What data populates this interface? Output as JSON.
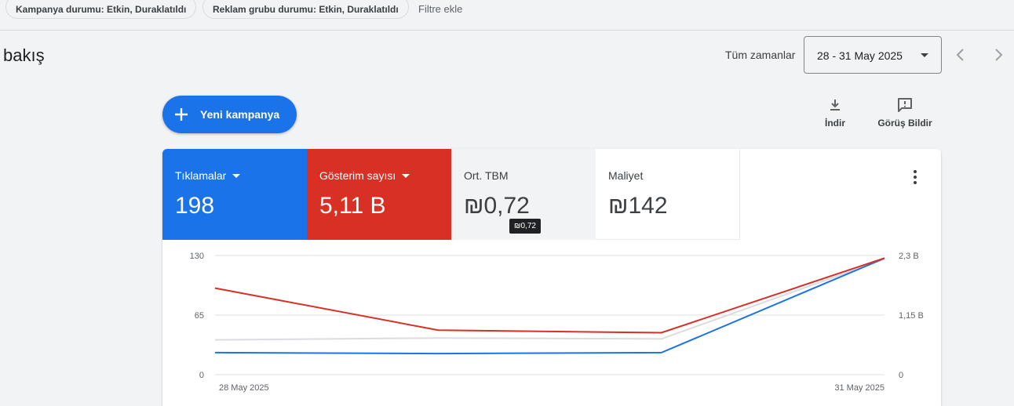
{
  "filters": {
    "chips": [
      "Kampanya durumu: Etkin, Duraklatıldı",
      "Reklam grubu durumu: Etkin, Duraklatıldı"
    ],
    "add_filter": "Filtre ekle"
  },
  "page": {
    "title": "bakış"
  },
  "date_range": {
    "label": "Tüm zamanlar",
    "value": "28 - 31 May 2025"
  },
  "actions": {
    "new_campaign": "Yeni kampanya",
    "download": "İndir",
    "feedback": "Görüş Bildir"
  },
  "metrics": [
    {
      "label": "Tıklamalar",
      "value": "198",
      "color": "#1a73e8"
    },
    {
      "label": "Gösterim sayısı",
      "value": "5,11 B",
      "color": "#d93025"
    },
    {
      "label": "Ort. TBM",
      "value": "₪0,72"
    },
    {
      "label": "Maliyet",
      "value": "₪142"
    }
  ],
  "tooltip": "₪0,72",
  "chart_data": {
    "type": "line",
    "x": [
      "28 May 2025",
      "29 May 2025",
      "30 May 2025",
      "31 May 2025"
    ],
    "x_tick_labels": [
      "28 May 2025",
      "31 May 2025"
    ],
    "y_left": {
      "ticks": [
        "130",
        "65",
        "0"
      ],
      "range": [
        0,
        130
      ]
    },
    "y_right": {
      "ticks": [
        "2,3 B",
        "1,15 B",
        "0"
      ],
      "range": [
        0,
        2.3
      ]
    },
    "grid": true,
    "series": [
      {
        "axis": "left",
        "color": "#1a73e8",
        "values": [
          24,
          23,
          24,
          127
        ]
      },
      {
        "axis": "right",
        "color": "#d93025",
        "values": [
          1.67,
          0.86,
          0.81,
          2.25
        ]
      },
      {
        "axis": "left",
        "color": "#dadce0",
        "values": [
          38,
          40,
          39,
          126
        ]
      }
    ]
  }
}
